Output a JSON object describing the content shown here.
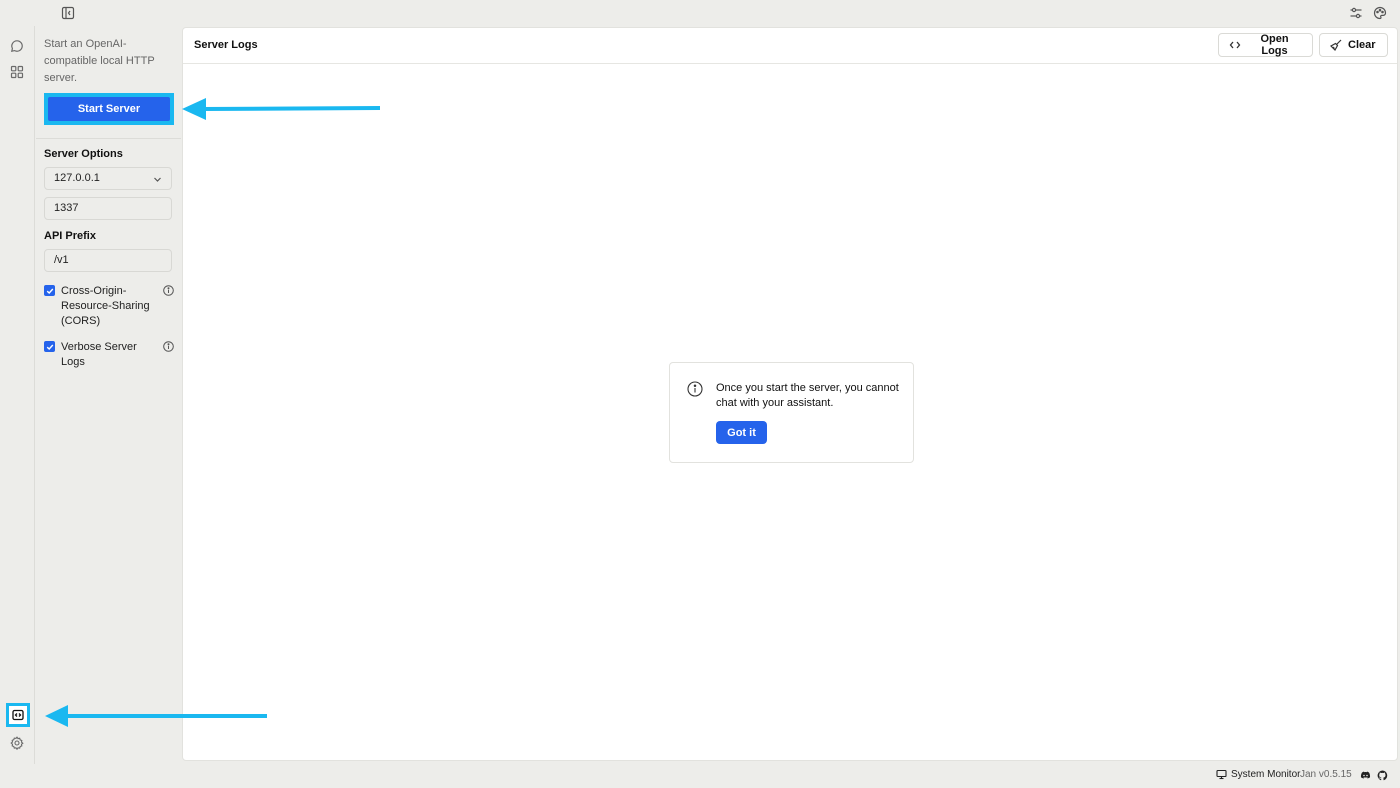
{
  "sidebar": {
    "description": "Start an OpenAI-compatible local HTTP server.",
    "start_button_label": "Start Server",
    "server_options_title": "Server Options",
    "host_value": "127.0.0.1",
    "port_value": "1337",
    "api_prefix_title": "API Prefix",
    "api_prefix_value": "/v1",
    "cors": {
      "label": "Cross-Origin-Resource-Sharing (CORS)",
      "checked": true
    },
    "verbose": {
      "label": "Verbose Server Logs",
      "checked": true
    }
  },
  "main": {
    "title": "Server Logs",
    "open_logs_label": "Open Logs",
    "clear_label": "Clear"
  },
  "notice": {
    "text": "Once you start the server, you cannot chat with your assistant.",
    "button_label": "Got it"
  },
  "footer": {
    "system_monitor_label": "System Monitor",
    "version": "Jan v0.5.15"
  },
  "icons": {
    "topbar_left": "sidebar-toggle-icon",
    "topbar_right": [
      "sliders-icon",
      "palette-icon"
    ],
    "rail": [
      "chat-icon",
      "grid-icon",
      "local-api-server-icon",
      "gear-icon"
    ],
    "footer": [
      "monitor-icon",
      "discord-icon",
      "github-icon"
    ]
  },
  "colors": {
    "accent": "#2563eb",
    "annotation": "#1ab8f0",
    "background": "#ededea"
  }
}
